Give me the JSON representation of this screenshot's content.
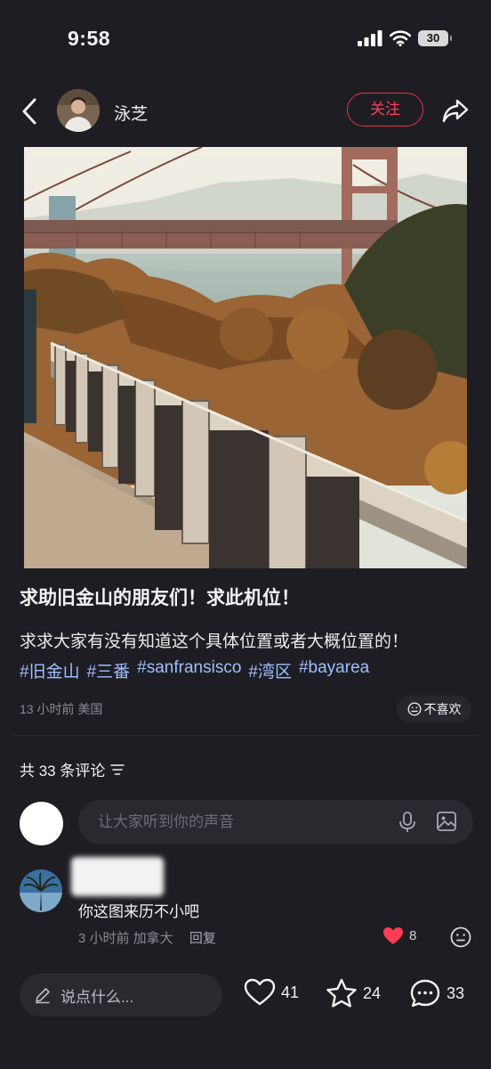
{
  "status": {
    "time": "9:58",
    "battery": "30"
  },
  "header": {
    "username": "泳芝",
    "follow_label": "关注"
  },
  "post": {
    "title": "求助旧金山的朋友们！求此机位！",
    "body": "求求大家有没有知道这个具体位置或者大概位置的！",
    "tags": [
      "#旧金山",
      "#三番",
      "#sanfransisco",
      "#湾区",
      "#bayarea"
    ],
    "meta": "13 小时前 美国",
    "dislike_label": "不喜欢"
  },
  "comments": {
    "count_label": "共 33 条评论",
    "input_placeholder": "让大家听到你的声音",
    "items": [
      {
        "text": "你这图来历不小吧",
        "time": "3 小时前 加拿大",
        "reply_label": "回复",
        "likes": "8"
      }
    ]
  },
  "bottom_bar": {
    "say_placeholder": "说点什么...",
    "likes": "41",
    "collects": "24",
    "comments": "33"
  },
  "colors": {
    "accent": "#ff4059",
    "tag": "#9ebfff",
    "background": "#1e1d23"
  }
}
